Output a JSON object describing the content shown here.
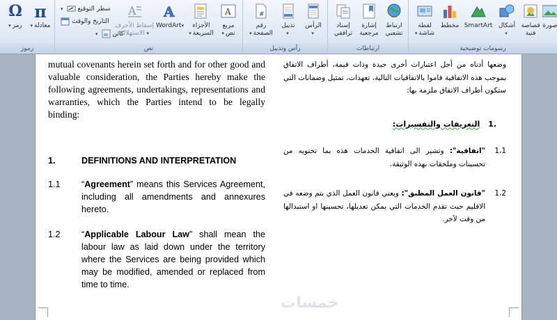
{
  "ribbon": {
    "groups": {
      "symbols": "رموز",
      "text": "نص",
      "header_footer": "رأس وتذييل",
      "links": "ارتباطات",
      "illustrations": "رسومات توضيحية"
    },
    "symbols": {
      "symbol": "رمز",
      "equation": "معادلة",
      "symbol_glyph": "Ω",
      "equation_glyph": "π"
    },
    "text": {
      "signature_line": "سطر التوقيع",
      "date_time": "التاريخ والوقت",
      "object": "كائن",
      "drop_cap_line1": "إسقاط الأحرف",
      "drop_cap_line2": "الاستهلالية",
      "wordart": "WordArt",
      "quick_parts_line1": "الأجزاء",
      "quick_parts_line2": "السريعة",
      "text_box_line1": "مربع",
      "text_box_line2": "نص"
    },
    "header_footer": {
      "page_number_line1": "رقم",
      "page_number_line2": "الصفحة",
      "footer": "تذييل",
      "header": "الرأس"
    },
    "links": {
      "cross_reference_line1": "إسناد",
      "cross_reference_line2": "ترافقي",
      "bookmark_line1": "إشارة",
      "bookmark_line2": "مرجعية",
      "hyperlink_line1": "ارتباط",
      "hyperlink_line2": "تشعبي"
    },
    "illustrations": {
      "screenshot_line1": "لقطة",
      "screenshot_line2": "شاشة",
      "chart": "مخطط",
      "smartart": "SmartArt",
      "shapes": "أشكال",
      "clip_art_line1": "قصاصة",
      "clip_art_line2": "فنية",
      "picture": "صورة"
    }
  },
  "document": {
    "left": {
      "intro": "mutual covenants herein set forth and for other good and valuable consideration, the Parties hereby make the following agreements, undertakings, representations and warranties, which the Parties intend to be legally binding:",
      "heading_num": "1.",
      "heading": "DEFINITIONS AND INTERPRETATION",
      "c1_num": "1.1",
      "c1_open": "“",
      "c1_term": "Agreement",
      "c1_text": "” means this Services Agreement, including all amendments and annexures hereto.",
      "c2_num": "1.2",
      "c2_open": "“",
      "c2_term": "Applicable Labour Law",
      "c2_text": "” shall mean the labour law as laid down under the territory where the Services are being provided which may be modified, amended or replaced from time to time."
    },
    "right": {
      "intro": "وضعها أدناه من أجل اعتبارات أخرى جيدة وذات قيمة، أطراف الاتفاق بموجب هذه الاتفاقية قاموا بالاتفاقيات التالية، تعهدات، تمثيل وضمانات التي ستكون أطراف الاتفاق ملزمة بها:",
      "heading_num": ".1",
      "heading": "التعريفات والتفسيرات:",
      "c1_num": "1،1",
      "c1_term": "\"اتفاقية\":",
      "c1_text": "وتشير الى اتفاقية الخدمات هذه بما تحتويه من تحسينات وملحقات بهذه الوثيقة.",
      "c2_num": "1،2",
      "c2_term": "\"قانون العمل المطبق\":",
      "c2_text": "ويعني قانون العمل الذي يتم وضعه في الاقليم حيث تقدم الخدمات التي يمكن تعديلها، تحسينها او استبدالها من وقت لآخر."
    },
    "watermark": "خمسات"
  }
}
